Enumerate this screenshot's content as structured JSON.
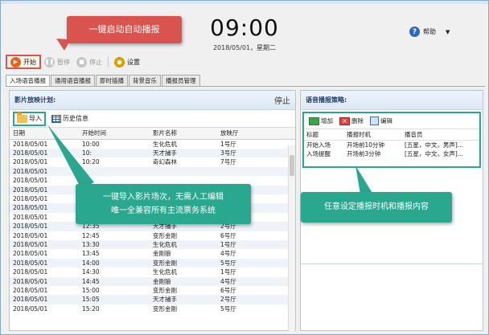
{
  "header": {
    "clock": "09:00",
    "date": "2018/05/01，星期二",
    "help_label": "帮助"
  },
  "toolbar": {
    "start": "开始",
    "pause": "暂停",
    "stop": "停止",
    "settings": "设置"
  },
  "tabs": [
    "入场语音播报",
    "通用语音播报",
    "即时插播",
    "背景音乐",
    "播报员管理"
  ],
  "left_panel": {
    "title": "影片放映计划:",
    "status": "停止",
    "import_label": "导入",
    "history_label": "历史信息",
    "columns": [
      "日期",
      "开始时间",
      "影片名称",
      "放映厅"
    ],
    "rows": [
      [
        "2018/05/01",
        "10:00",
        "生化危机",
        "1号厅"
      ],
      [
        "2018/05/01",
        "10:",
        "天才捕手",
        "3号厅"
      ],
      [
        "2018/05/01",
        "10:20",
        "奇幻森林",
        "7号厅"
      ],
      [
        "2018/05/01",
        "",
        "",
        ""
      ],
      [
        "2018/05/01",
        "",
        "",
        ""
      ],
      [
        "2018/05/01",
        "",
        "",
        ""
      ],
      [
        "2018/05/01",
        "",
        "",
        ""
      ],
      [
        "2018/05/01",
        "",
        "",
        ""
      ],
      [
        "2018/05/01",
        "",
        "",
        ""
      ],
      [
        "2018/05/01",
        "12:35",
        "天才捕手",
        "2号厅"
      ],
      [
        "2018/05/01",
        "12:45",
        "变形金刚",
        "6号厅"
      ],
      [
        "2018/05/01",
        "13:30",
        "生化危机",
        "1号厅"
      ],
      [
        "2018/05/01",
        "13:45",
        "金刚狼",
        "4号厅"
      ],
      [
        "2018/05/01",
        "14:00",
        "变形金刚",
        "5号厅"
      ],
      [
        "2018/05/01",
        "14:30",
        "生化危机",
        "1号厅"
      ],
      [
        "2018/05/01",
        "14:45",
        "金刚狼",
        "4号厅"
      ],
      [
        "2018/05/01",
        "15:00",
        "变形金刚",
        "6号厅"
      ],
      [
        "2018/05/01",
        "15:05",
        "天才捕手",
        "2号厅"
      ],
      [
        "2018/05/01",
        "15:20",
        "变形金刚",
        "5号厅"
      ]
    ]
  },
  "right_panel": {
    "title": "语音播报策略:",
    "add_label": "增加",
    "delete_label": "删除",
    "edit_label": "编辑",
    "columns": [
      "标题",
      "播报时机",
      "播音员"
    ],
    "rows": [
      [
        "开始入场",
        "开场前10分钟",
        "[五星，中文，男声]..."
      ],
      [
        "入场提醒",
        "开场前3分钟",
        "[五星，中文，女声]..."
      ]
    ]
  },
  "callouts": {
    "auto_start": "一键启动自动播报",
    "import_line1": "一键导入影片场次，无需人工编辑",
    "import_line2": "唯一全兼容所有主流票务系统",
    "strategy": "任意设定播报时机和播报内容"
  },
  "colors": {
    "callout_red": "#d9534f",
    "callout_green": "#29a78f"
  }
}
